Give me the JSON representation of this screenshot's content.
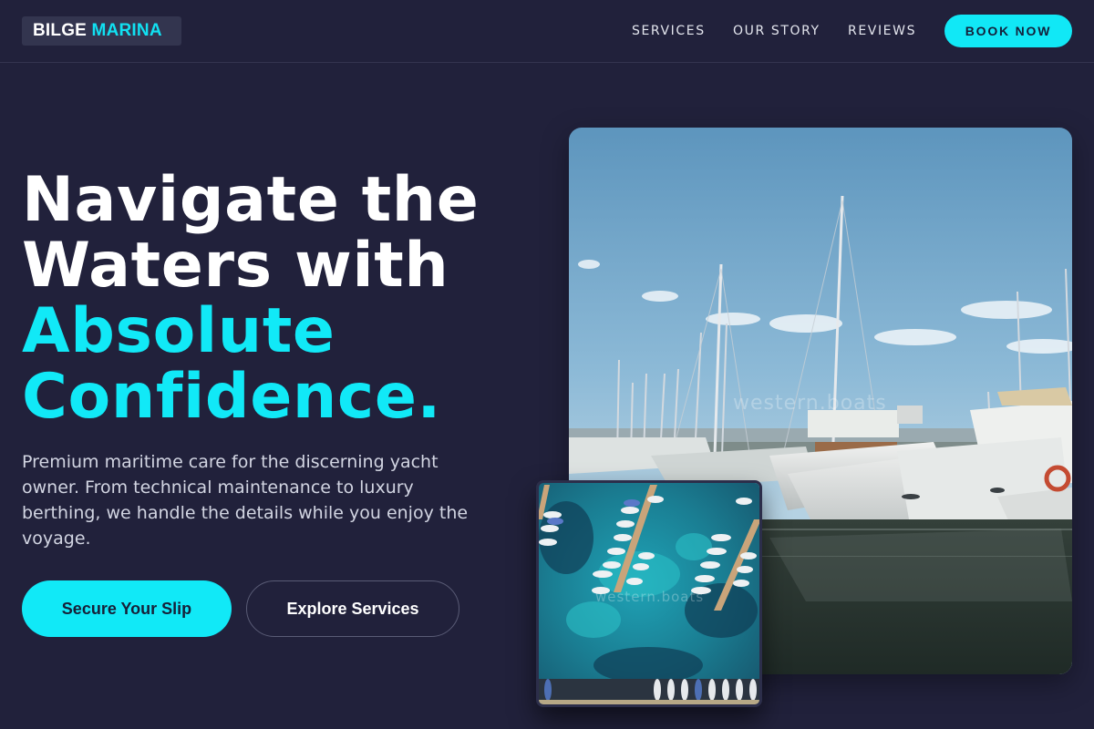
{
  "brand": {
    "word1": "BILGE",
    "word2": "MARINA"
  },
  "nav": {
    "links": [
      "SERVICES",
      "OUR STORY",
      "REVIEWS"
    ],
    "cta": "BOOK NOW"
  },
  "hero": {
    "headline_lines": [
      "Navigate the",
      "Waters with",
      "Absolute",
      "Confidence."
    ],
    "highlighted_lines": [
      2,
      3
    ],
    "description": "Premium maritime care for the discerning yacht owner. From technical maintenance to luxury berthing, we handle the details while you enjoy the voyage.",
    "primary_cta": "Secure Your Slip",
    "secondary_cta": "Explore Services"
  },
  "images": {
    "main": {
      "subject": "yachts-in-marina",
      "watermark": "western.boats"
    },
    "inset": {
      "subject": "aerial-marina-docks",
      "watermark": "western.boats"
    }
  },
  "colors": {
    "background": "#21213b",
    "accent": "#11e9f7",
    "text": "#ffffff",
    "muted_text": "#d2d5e2"
  }
}
